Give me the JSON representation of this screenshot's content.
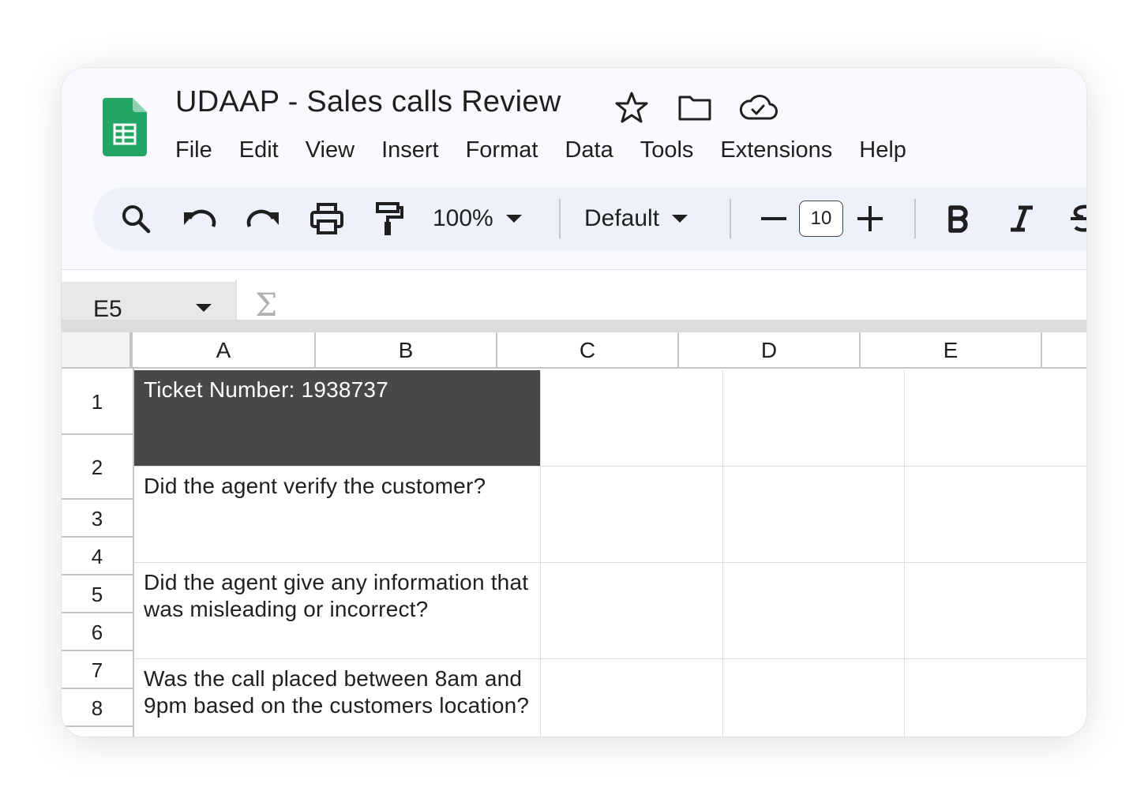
{
  "document": {
    "title": "UDAAP - Sales calls Review"
  },
  "menu": [
    "File",
    "Edit",
    "View",
    "Insert",
    "Format",
    "Data",
    "Tools",
    "Extensions",
    "Help"
  ],
  "toolbar": {
    "zoom": "100%",
    "font": "Default",
    "font_size": "10",
    "icons": [
      "search-icon",
      "undo-icon",
      "redo-icon",
      "print-icon",
      "paint-format-icon",
      "chevron-down-icon",
      "minus-icon",
      "plus-icon",
      "bold-icon",
      "italic-icon",
      "strikethrough-icon"
    ]
  },
  "formula_bar": {
    "cell_ref": "E5",
    "function_symbol": "Σ"
  },
  "columns": [
    "A",
    "B",
    "C",
    "D",
    "E"
  ],
  "rows": [
    "1",
    "2",
    "3",
    "4",
    "5",
    "6",
    "7",
    "8"
  ],
  "cells": {
    "a1": "Ticket Number: 1938737",
    "a3": "Did the agent verify the customer?",
    "a5": "Did the agent give any information that was misleading or incorrect?",
    "a7": "Was the call placed between 8am and 9pm based on the customers location?"
  },
  "colors": {
    "sheets_green": "#23a566",
    "header_row_fill": "#484848",
    "toolbar_bg": "#edf2fa"
  }
}
